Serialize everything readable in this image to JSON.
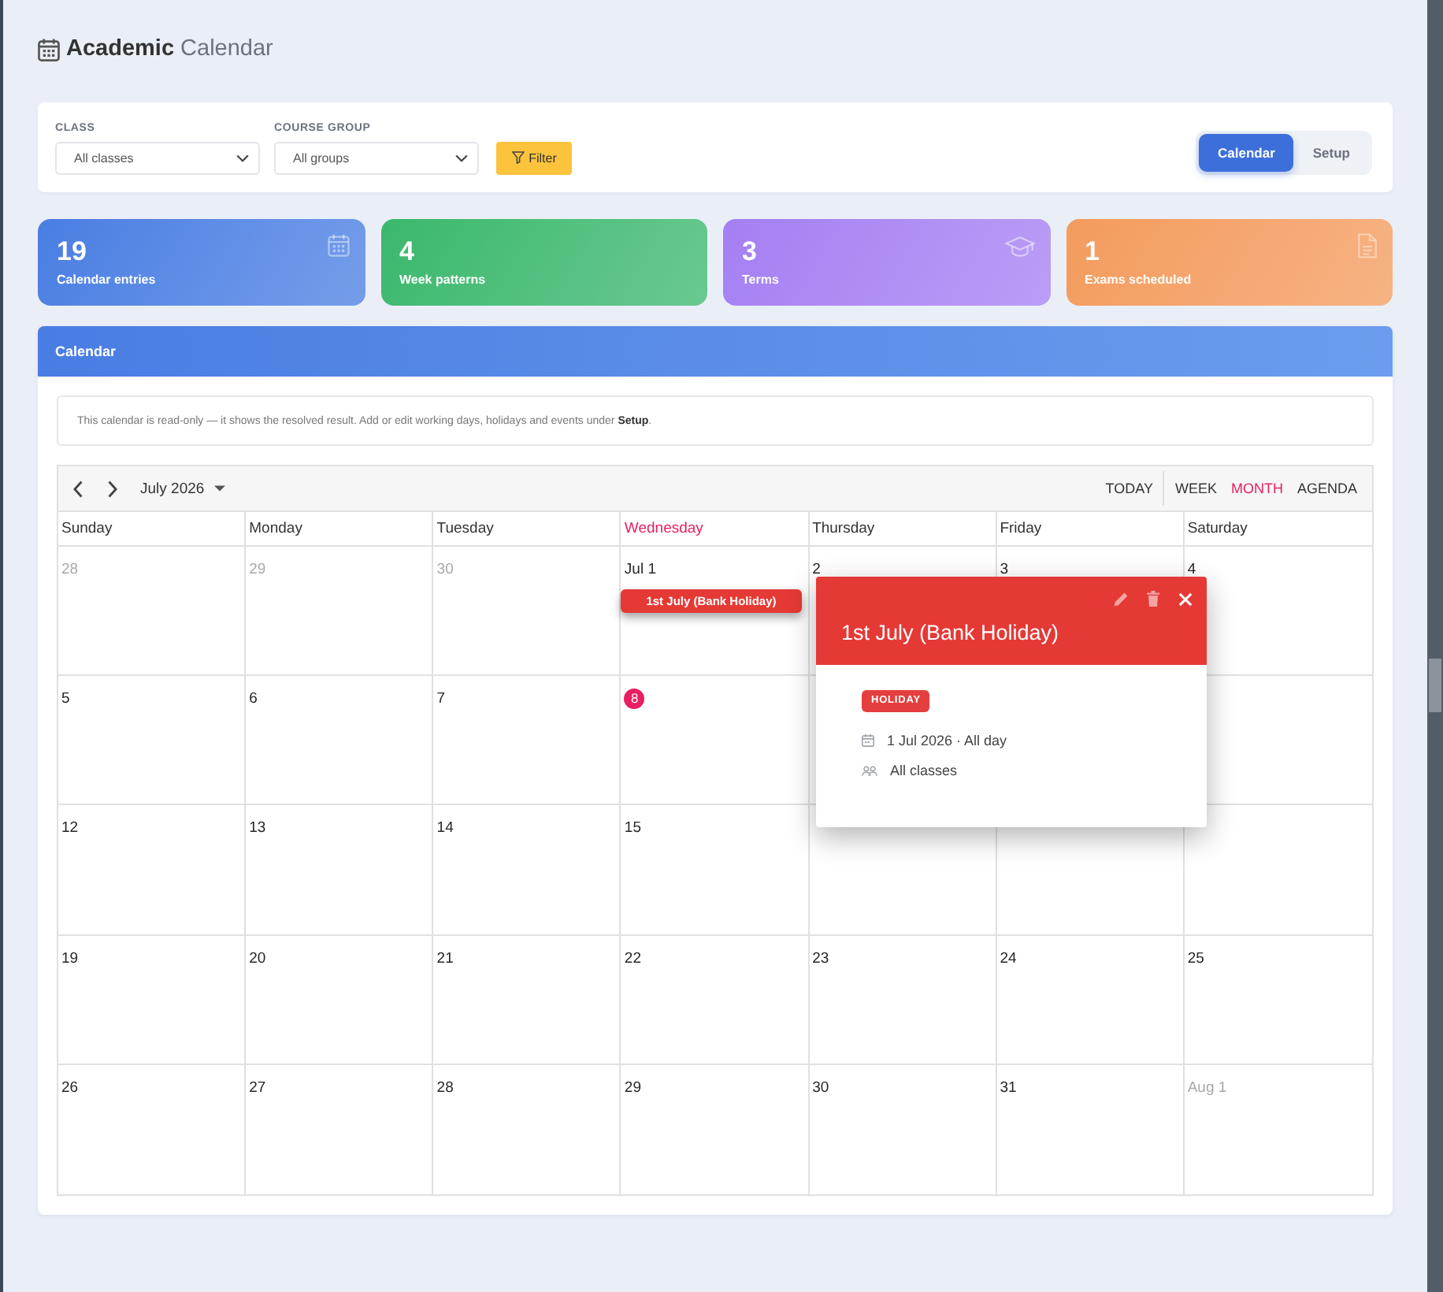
{
  "header": {
    "title": "**Academic** Calendar"
  },
  "filters": {
    "fields": [
      {
        "label": "CLASS",
        "value": "All classes"
      },
      {
        "label": "COURSE GROUP",
        "value": "All groups"
      }
    ],
    "button": "Filter"
  },
  "view_tabs": [
    {
      "label": "Calendar",
      "selected": true
    },
    {
      "label": "Setup",
      "selected": false
    }
  ],
  "stats": [
    {
      "value": "19",
      "label": "Calendar entries",
      "kind": "entries",
      "color": "#4a7ee3"
    },
    {
      "value": "4",
      "label": "Week patterns",
      "kind": "patterns",
      "color": "#3bb86d"
    },
    {
      "value": "3",
      "label": "Terms",
      "kind": "terms",
      "color": "#a57ff3"
    },
    {
      "value": "1",
      "label": "Exams scheduled",
      "kind": "exams",
      "color": "#f49b5d"
    }
  ],
  "calendar": {
    "title": "Calendar",
    "notice": "This calendar is read-only — it shows the resolved result. Add or edit working days, holidays and events under **Setup**.",
    "month": "July 2026",
    "today_button": "TODAY",
    "views": [
      {
        "label": "WEEK",
        "selected": false
      },
      {
        "label": "MONTH",
        "selected": true
      },
      {
        "label": "AGENDA",
        "selected": false
      }
    ],
    "weekdays": [
      {
        "label": "Sunday",
        "today": false
      },
      {
        "label": "Monday",
        "today": false
      },
      {
        "label": "Tuesday",
        "today": false
      },
      {
        "label": "Wednesday",
        "today": true
      },
      {
        "label": "Thursday",
        "today": false
      },
      {
        "label": "Friday",
        "today": false
      },
      {
        "label": "Saturday",
        "today": false
      }
    ],
    "weeks": [
      {
        "days": [
          {
            "day": "28",
            "outside": true,
            "today": false
          },
          {
            "day": "29",
            "outside": true,
            "today": false
          },
          {
            "day": "30",
            "outside": true,
            "today": false
          },
          {
            "day": "Jul 1",
            "outside": false,
            "today": false,
            "events": [
              {
                "title": "1st July (Bank Holiday)",
                "selected": true
              }
            ]
          },
          {
            "day": "2",
            "outside": false,
            "today": false
          },
          {
            "day": "3",
            "outside": false,
            "today": false
          },
          {
            "day": "4",
            "outside": false,
            "today": false
          }
        ]
      },
      {
        "days": [
          {
            "day": "5",
            "outside": false,
            "today": false
          },
          {
            "day": "6",
            "outside": false,
            "today": false
          },
          {
            "day": "7",
            "outside": false,
            "today": false
          },
          {
            "day": "8",
            "outside": false,
            "today": true
          }
        ]
      },
      {
        "days": [
          {
            "day": "12",
            "outside": false,
            "today": false
          },
          {
            "day": "13",
            "outside": false,
            "today": false
          },
          {
            "day": "14",
            "outside": false,
            "today": false
          },
          {
            "day": "15",
            "outside": false,
            "today": false
          }
        ]
      },
      {
        "days": [
          {
            "day": "19",
            "outside": false,
            "today": false
          },
          {
            "day": "20",
            "outside": false,
            "today": false
          },
          {
            "day": "21",
            "outside": false,
            "today": false
          },
          {
            "day": "22",
            "outside": false,
            "today": false
          },
          {
            "day": "23",
            "outside": false,
            "today": false
          },
          {
            "day": "24",
            "outside": false,
            "today": false
          },
          {
            "day": "25",
            "outside": false,
            "today": false
          }
        ]
      },
      {
        "days": [
          {
            "day": "26",
            "outside": false,
            "today": false
          },
          {
            "day": "27",
            "outside": false,
            "today": false
          },
          {
            "day": "28",
            "outside": false,
            "today": false
          },
          {
            "day": "29",
            "outside": false,
            "today": false
          },
          {
            "day": "30",
            "outside": false,
            "today": false
          },
          {
            "day": "31",
            "outside": false,
            "today": false
          },
          {
            "day": "Aug 1",
            "outside": true,
            "today": false
          }
        ]
      }
    ]
  },
  "popup": {
    "title": "1st July (Bank Holiday)",
    "tag": "HOLIDAY",
    "date": "1 Jul 2026 · All day",
    "audience": "All classes"
  }
}
